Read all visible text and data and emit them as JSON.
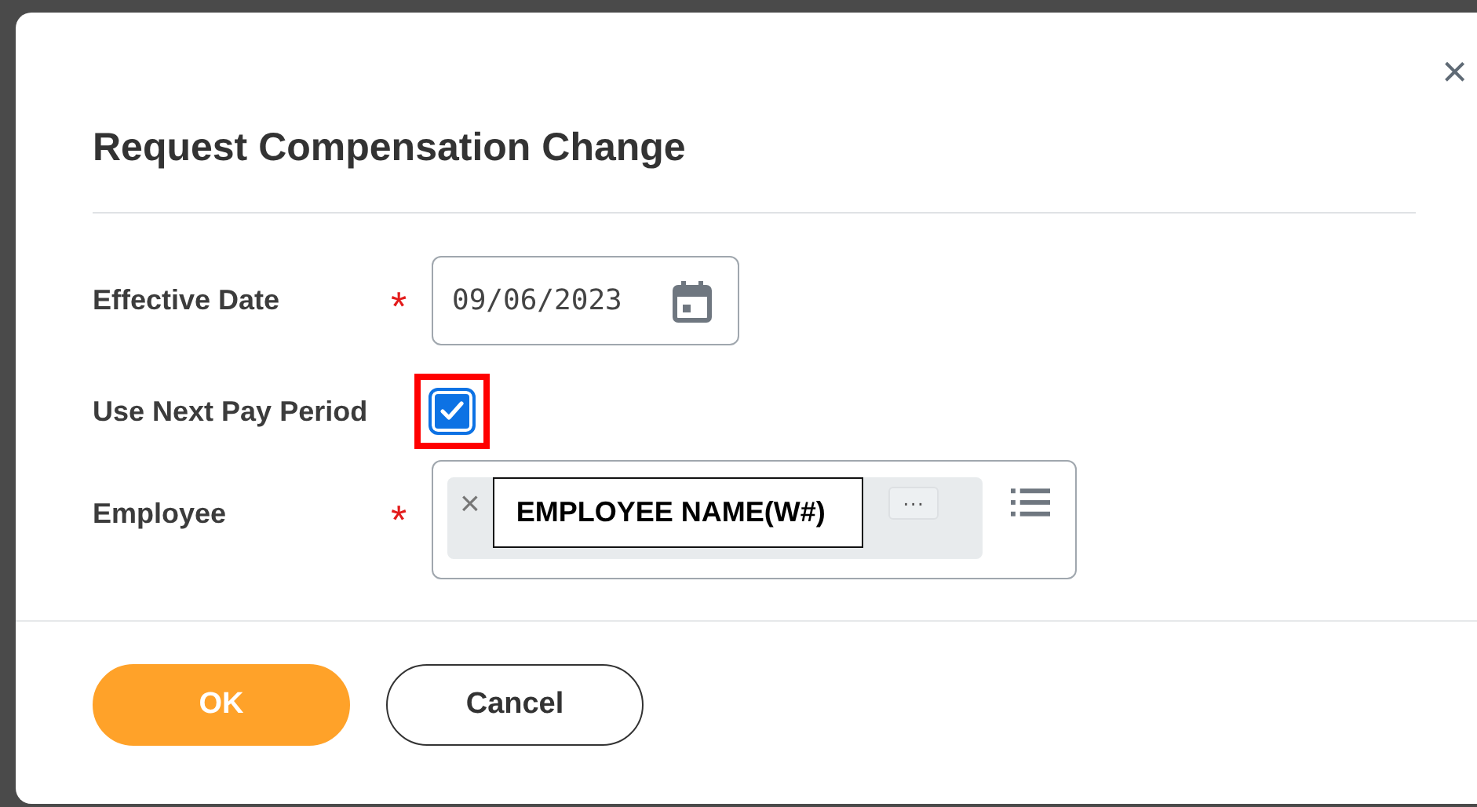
{
  "dialog": {
    "title": "Request Compensation Change",
    "close": "×"
  },
  "fields": [
    {
      "kind": "date",
      "label": "Effective Date",
      "required_marker": "*",
      "value": "09/06/2023"
    },
    {
      "kind": "checkbox",
      "label": "Use Next Pay Period",
      "checked": true,
      "highlighted": true
    },
    {
      "kind": "prompt",
      "label": "Employee",
      "required_marker": "*",
      "value": "EMPLOYEE NAME(W#)",
      "remove": "×",
      "more": "···"
    }
  ],
  "buttons": [
    {
      "label": "OK",
      "primary": true
    },
    {
      "label": "Cancel",
      "primary": false
    }
  ]
}
